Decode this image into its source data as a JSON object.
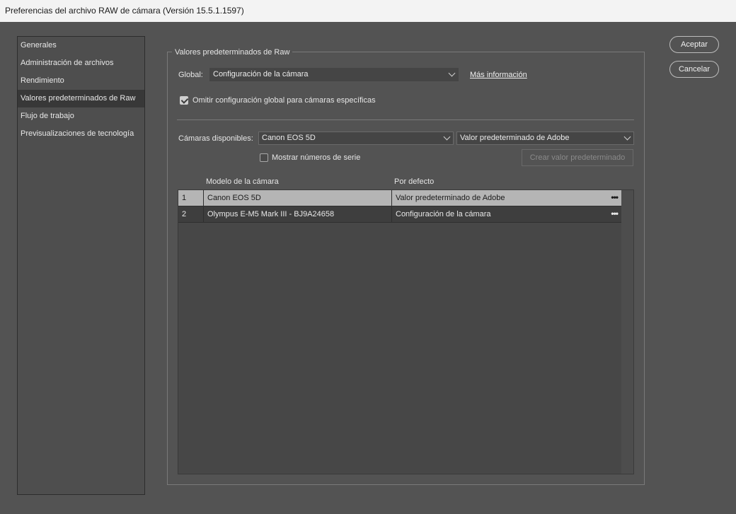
{
  "window": {
    "title": "Preferencias del archivo RAW de cámara  (Versión 15.5.1.1597)"
  },
  "sidebar": {
    "items": [
      {
        "label": "Generales"
      },
      {
        "label": "Administración de archivos"
      },
      {
        "label": "Rendimiento"
      },
      {
        "label": "Valores predeterminados de Raw"
      },
      {
        "label": "Flujo de trabajo"
      },
      {
        "label": "Previsualizaciones de tecnología"
      }
    ],
    "active_index": 3
  },
  "buttons": {
    "ok": "Aceptar",
    "cancel": "Cancelar"
  },
  "panel": {
    "title": "Valores predeterminados de Raw",
    "global_label": "Global:",
    "global_value": "Configuración de la cámara",
    "more_info": "Más información",
    "override_checkbox": {
      "label": "Omitir configuración global para cámaras específicas",
      "checked": true
    },
    "cameras_label": "Cámaras disponibles:",
    "camera_value": "Canon EOS 5D",
    "default_value": "Valor predeterminado de Adobe",
    "serial_checkbox": {
      "label": "Mostrar números de serie",
      "checked": false
    },
    "create_default": "Crear valor predeterminado"
  },
  "table": {
    "headers": {
      "model": "Modelo de la cámara",
      "default": "Por defecto"
    },
    "rows": [
      {
        "num": "1",
        "model": "Canon EOS 5D",
        "default": "Valor predeterminado de Adobe",
        "selected": true
      },
      {
        "num": "2",
        "model": "Olympus E-M5 Mark III - BJ9A24658",
        "default": "Configuración de la cámara",
        "selected": false
      }
    ],
    "more_glyph": "•••"
  }
}
